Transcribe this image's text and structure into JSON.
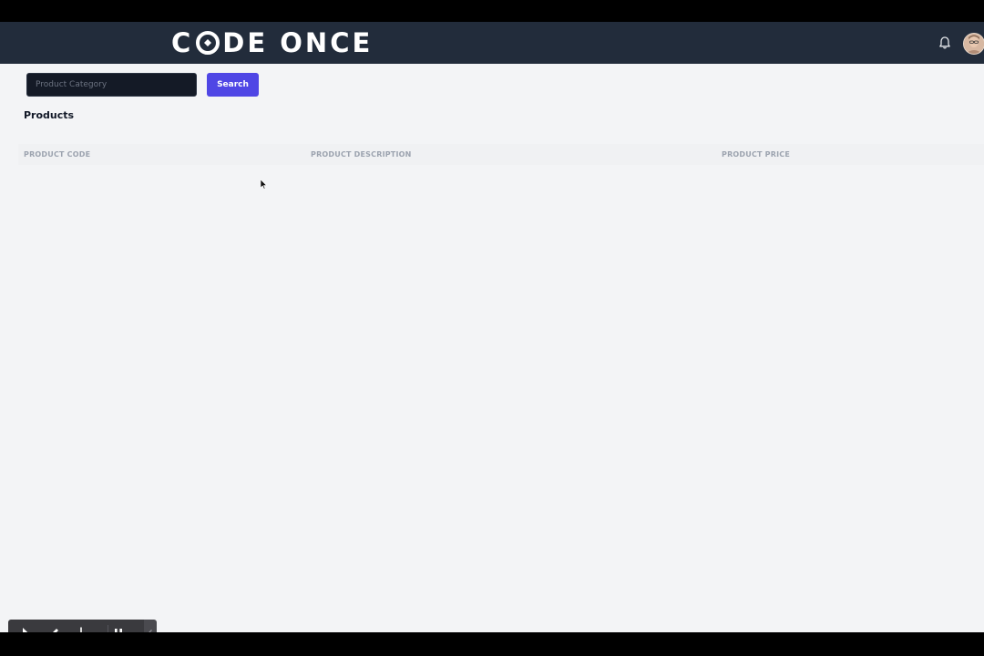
{
  "header": {
    "logo_text": "CODE ONCE",
    "logo_left": "C",
    "logo_right": "DE ONCE"
  },
  "search": {
    "placeholder": "Product Category",
    "value": "",
    "button_label": "Search"
  },
  "products": {
    "title": "Products",
    "columns": [
      "PRODUCT CODE",
      "PRODUCT DESCRIPTION",
      "PRODUCT PRICE"
    ],
    "rows": []
  },
  "icons": {
    "bell": "bell-icon",
    "avatar": "user-avatar",
    "toolbar": [
      "pointer-icon",
      "pencil-icon",
      "broom-icon",
      "pause-icon",
      "chevron-left-icon"
    ]
  },
  "colors": {
    "header_bg": "#222c3b",
    "page_bg": "#f3f4f6",
    "accent": "#4f46e5",
    "input_bg": "#141a26"
  }
}
